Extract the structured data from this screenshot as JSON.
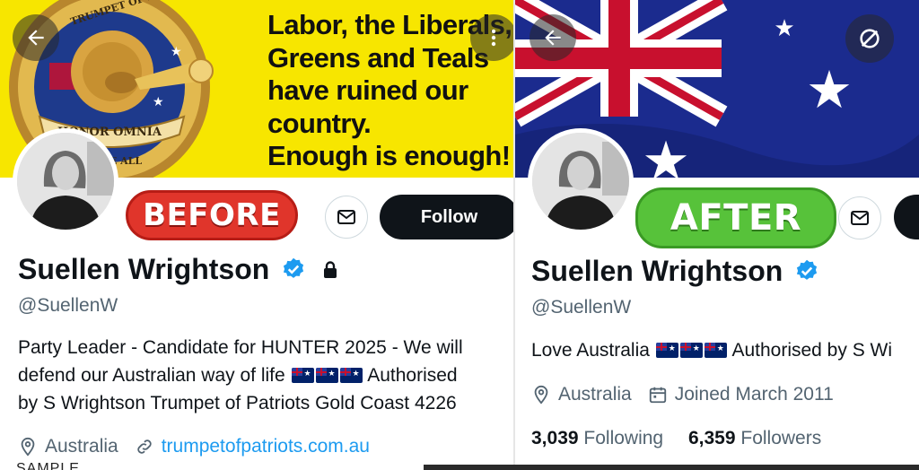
{
  "before": {
    "stamp": "BEFORE",
    "banner_text": [
      "Labor, the Liberals,",
      "Greens and Teals",
      "have ruined our",
      "country.",
      "Enough is enough!"
    ],
    "logo_text": [
      "TRUMPET OF PATRIOTS",
      "HONOR OMNIA",
      "ABOVE ALL"
    ],
    "follow_label": "Follow",
    "name": "Suellen Wrightson",
    "handle": "@SuellenW",
    "bio_lines": [
      "Party Leader - Candidate for HUNTER 2025 - We will",
      "defend our Australian way of life",
      "Authorised",
      "by S Wrightson Trumpet of Patriots Gold Coast 4226"
    ],
    "location": "Australia",
    "website": "trumpetofpatriots.com.au",
    "cutoff_text": "SAMPLE"
  },
  "after": {
    "stamp": "AFTER",
    "name": "Suellen Wrightson",
    "handle": "@SuellenW",
    "bio_prefix": "Love Australia",
    "bio_suffix": "Authorised by S Wi",
    "location": "Australia",
    "joined": "Joined March 2011",
    "following_count": "3,039",
    "following_label": "Following",
    "followers_count": "6,359",
    "followers_label": "Followers"
  },
  "icons": {
    "back": "arrow-left-icon",
    "more": "more-vertical-icon",
    "unlink": "slash-circle-icon",
    "message": "envelope-icon",
    "verified": "verified-badge-icon",
    "lock": "lock-icon",
    "location": "location-pin-icon",
    "link": "link-icon",
    "calendar": "calendar-icon"
  },
  "colors": {
    "accent": "#1d9bf0",
    "before_stamp": "#e0352b",
    "after_stamp": "#57c23a",
    "banner_yellow": "#f7e600"
  }
}
